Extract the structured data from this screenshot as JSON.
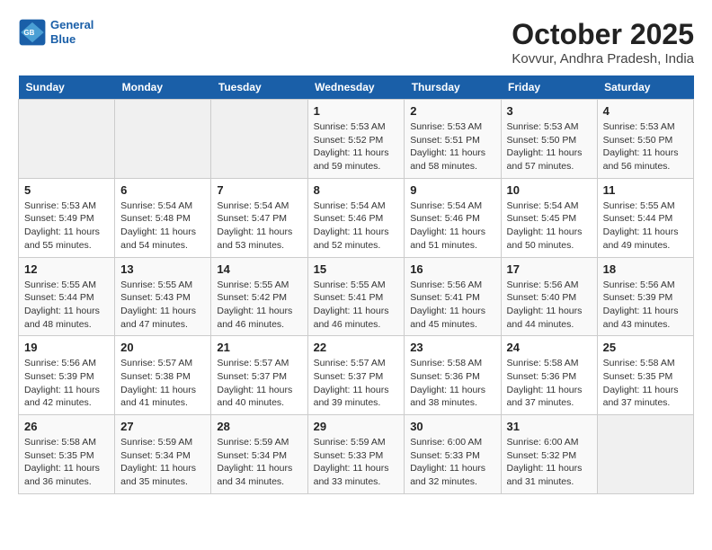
{
  "header": {
    "logo_line1": "General",
    "logo_line2": "Blue",
    "month": "October 2025",
    "location": "Kovvur, Andhra Pradesh, India"
  },
  "weekdays": [
    "Sunday",
    "Monday",
    "Tuesday",
    "Wednesday",
    "Thursday",
    "Friday",
    "Saturday"
  ],
  "weeks": [
    [
      {
        "day": "",
        "info": ""
      },
      {
        "day": "",
        "info": ""
      },
      {
        "day": "",
        "info": ""
      },
      {
        "day": "1",
        "info": "Sunrise: 5:53 AM\nSunset: 5:52 PM\nDaylight: 11 hours\nand 59 minutes."
      },
      {
        "day": "2",
        "info": "Sunrise: 5:53 AM\nSunset: 5:51 PM\nDaylight: 11 hours\nand 58 minutes."
      },
      {
        "day": "3",
        "info": "Sunrise: 5:53 AM\nSunset: 5:50 PM\nDaylight: 11 hours\nand 57 minutes."
      },
      {
        "day": "4",
        "info": "Sunrise: 5:53 AM\nSunset: 5:50 PM\nDaylight: 11 hours\nand 56 minutes."
      }
    ],
    [
      {
        "day": "5",
        "info": "Sunrise: 5:53 AM\nSunset: 5:49 PM\nDaylight: 11 hours\nand 55 minutes."
      },
      {
        "day": "6",
        "info": "Sunrise: 5:54 AM\nSunset: 5:48 PM\nDaylight: 11 hours\nand 54 minutes."
      },
      {
        "day": "7",
        "info": "Sunrise: 5:54 AM\nSunset: 5:47 PM\nDaylight: 11 hours\nand 53 minutes."
      },
      {
        "day": "8",
        "info": "Sunrise: 5:54 AM\nSunset: 5:46 PM\nDaylight: 11 hours\nand 52 minutes."
      },
      {
        "day": "9",
        "info": "Sunrise: 5:54 AM\nSunset: 5:46 PM\nDaylight: 11 hours\nand 51 minutes."
      },
      {
        "day": "10",
        "info": "Sunrise: 5:54 AM\nSunset: 5:45 PM\nDaylight: 11 hours\nand 50 minutes."
      },
      {
        "day": "11",
        "info": "Sunrise: 5:55 AM\nSunset: 5:44 PM\nDaylight: 11 hours\nand 49 minutes."
      }
    ],
    [
      {
        "day": "12",
        "info": "Sunrise: 5:55 AM\nSunset: 5:44 PM\nDaylight: 11 hours\nand 48 minutes."
      },
      {
        "day": "13",
        "info": "Sunrise: 5:55 AM\nSunset: 5:43 PM\nDaylight: 11 hours\nand 47 minutes."
      },
      {
        "day": "14",
        "info": "Sunrise: 5:55 AM\nSunset: 5:42 PM\nDaylight: 11 hours\nand 46 minutes."
      },
      {
        "day": "15",
        "info": "Sunrise: 5:55 AM\nSunset: 5:41 PM\nDaylight: 11 hours\nand 46 minutes."
      },
      {
        "day": "16",
        "info": "Sunrise: 5:56 AM\nSunset: 5:41 PM\nDaylight: 11 hours\nand 45 minutes."
      },
      {
        "day": "17",
        "info": "Sunrise: 5:56 AM\nSunset: 5:40 PM\nDaylight: 11 hours\nand 44 minutes."
      },
      {
        "day": "18",
        "info": "Sunrise: 5:56 AM\nSunset: 5:39 PM\nDaylight: 11 hours\nand 43 minutes."
      }
    ],
    [
      {
        "day": "19",
        "info": "Sunrise: 5:56 AM\nSunset: 5:39 PM\nDaylight: 11 hours\nand 42 minutes."
      },
      {
        "day": "20",
        "info": "Sunrise: 5:57 AM\nSunset: 5:38 PM\nDaylight: 11 hours\nand 41 minutes."
      },
      {
        "day": "21",
        "info": "Sunrise: 5:57 AM\nSunset: 5:37 PM\nDaylight: 11 hours\nand 40 minutes."
      },
      {
        "day": "22",
        "info": "Sunrise: 5:57 AM\nSunset: 5:37 PM\nDaylight: 11 hours\nand 39 minutes."
      },
      {
        "day": "23",
        "info": "Sunrise: 5:58 AM\nSunset: 5:36 PM\nDaylight: 11 hours\nand 38 minutes."
      },
      {
        "day": "24",
        "info": "Sunrise: 5:58 AM\nSunset: 5:36 PM\nDaylight: 11 hours\nand 37 minutes."
      },
      {
        "day": "25",
        "info": "Sunrise: 5:58 AM\nSunset: 5:35 PM\nDaylight: 11 hours\nand 37 minutes."
      }
    ],
    [
      {
        "day": "26",
        "info": "Sunrise: 5:58 AM\nSunset: 5:35 PM\nDaylight: 11 hours\nand 36 minutes."
      },
      {
        "day": "27",
        "info": "Sunrise: 5:59 AM\nSunset: 5:34 PM\nDaylight: 11 hours\nand 35 minutes."
      },
      {
        "day": "28",
        "info": "Sunrise: 5:59 AM\nSunset: 5:34 PM\nDaylight: 11 hours\nand 34 minutes."
      },
      {
        "day": "29",
        "info": "Sunrise: 5:59 AM\nSunset: 5:33 PM\nDaylight: 11 hours\nand 33 minutes."
      },
      {
        "day": "30",
        "info": "Sunrise: 6:00 AM\nSunset: 5:33 PM\nDaylight: 11 hours\nand 32 minutes."
      },
      {
        "day": "31",
        "info": "Sunrise: 6:00 AM\nSunset: 5:32 PM\nDaylight: 11 hours\nand 31 minutes."
      },
      {
        "day": "",
        "info": ""
      }
    ]
  ]
}
